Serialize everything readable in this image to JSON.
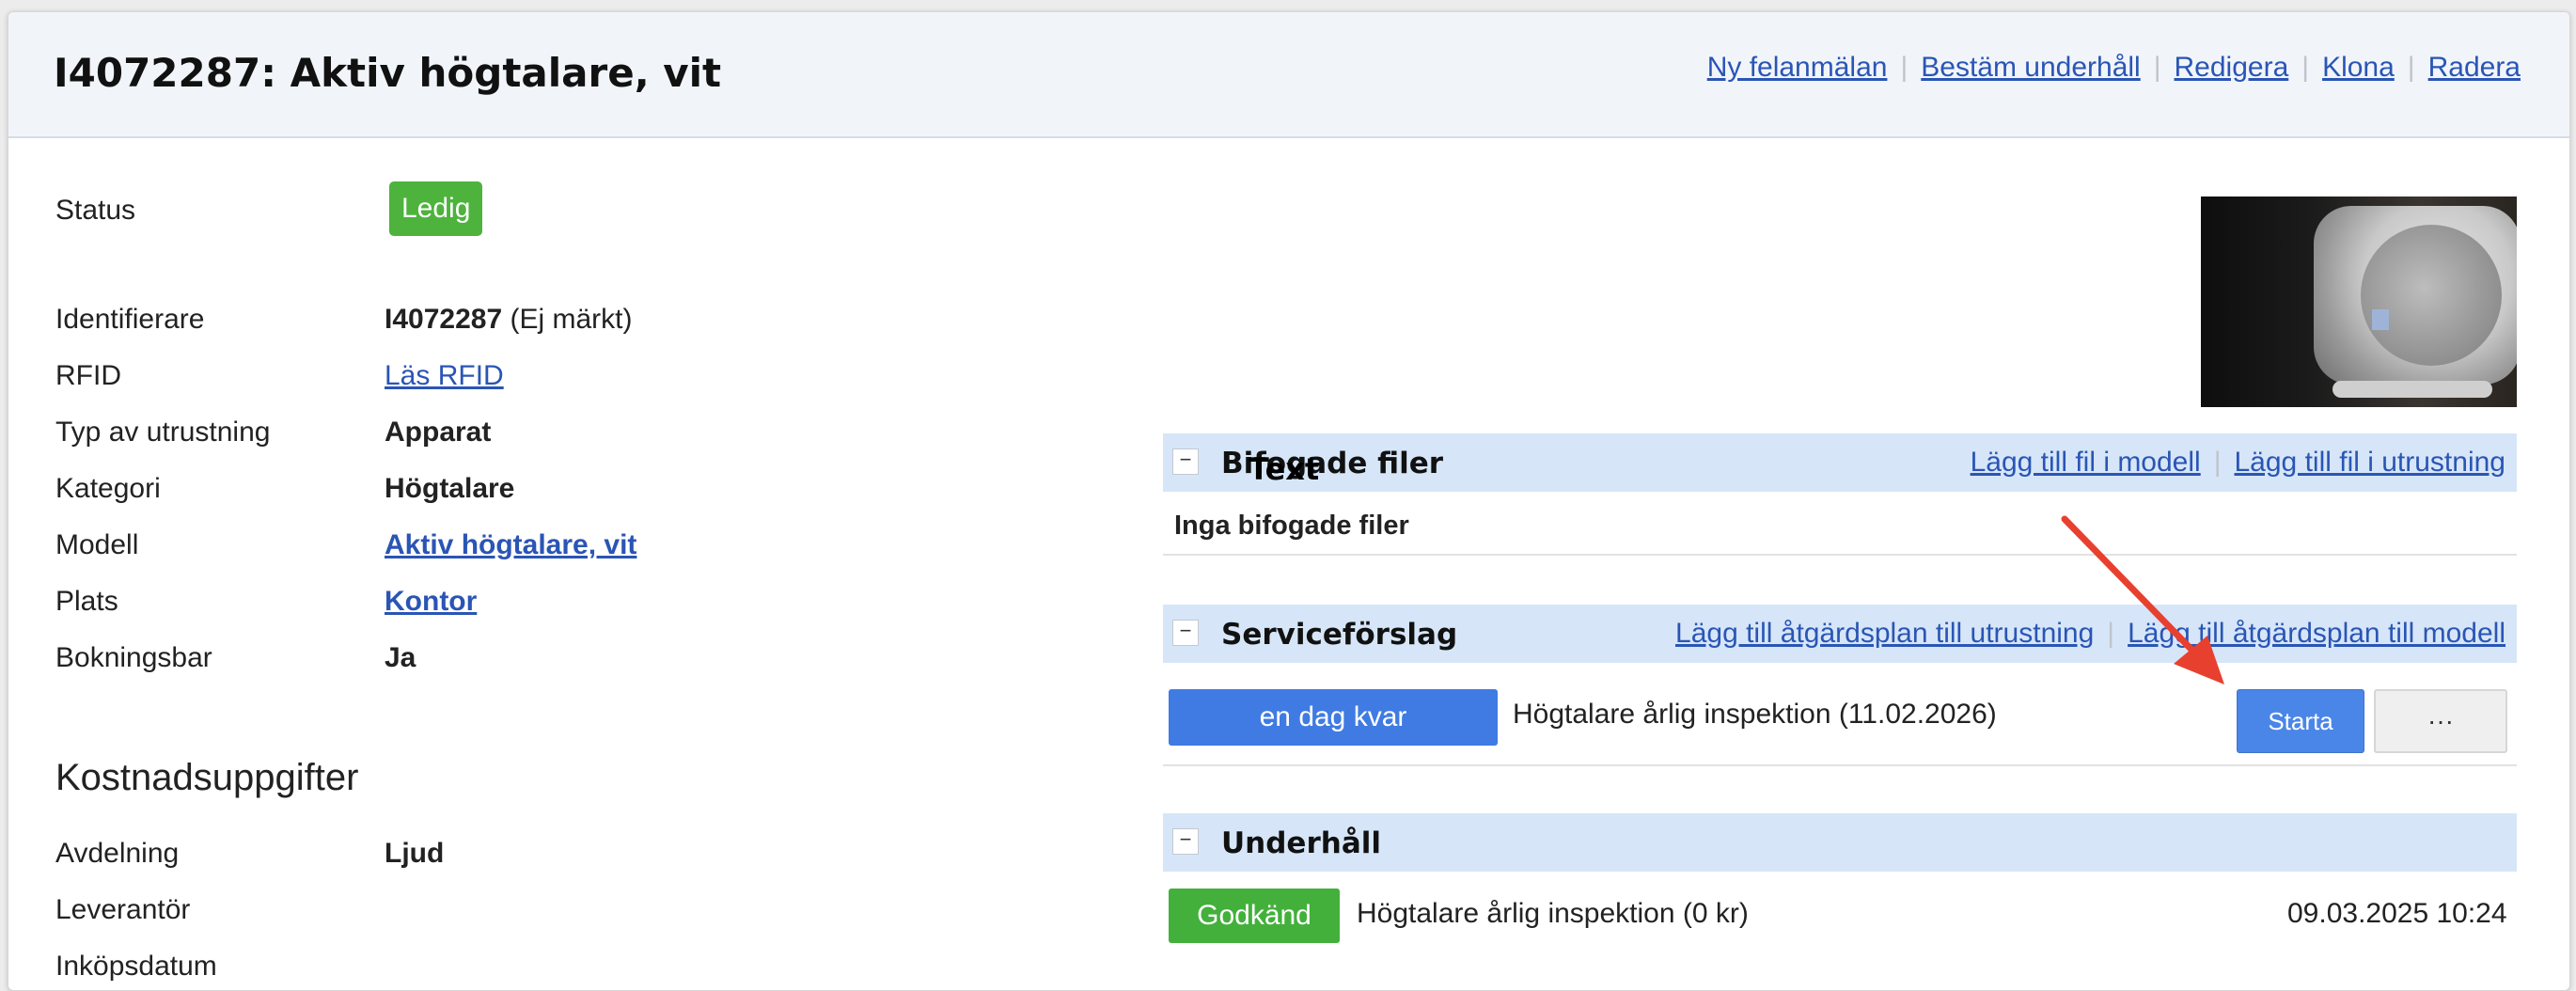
{
  "header": {
    "title": "I4072287: Aktiv högtalare, vit",
    "actions": [
      "Ny felanmälan",
      "Bestäm underhåll",
      "Redigera",
      "Klona",
      "Radera"
    ]
  },
  "details": {
    "status_label": "Status",
    "status_badge": "Ledig",
    "identifier_label": "Identifierare",
    "identifier_value": "I4072287",
    "identifier_note": "(Ej märkt)",
    "rfid_label": "RFID",
    "rfid_link": "Läs RFID",
    "type_label": "Typ av utrustning",
    "type_value": "Apparat",
    "category_label": "Kategori",
    "category_value": "Högtalare",
    "model_label": "Modell",
    "model_link": "Aktiv högtalare, vit",
    "place_label": "Plats",
    "place_link": "Kontor",
    "bookable_label": "Bokningsbar",
    "bookable_value": "Ja"
  },
  "costs": {
    "heading": "Kostnadsuppgifter",
    "department_label": "Avdelning",
    "department_value": "Ljud",
    "supplier_label": "Leverantör",
    "purchase_date_label": "Inköpsdatum"
  },
  "attachments": {
    "title": "Bifogade filer",
    "toggle": "−",
    "links": [
      "Lägg till fil i modell",
      "Lägg till fil i utrustning"
    ],
    "empty_text": "Inga bifogade filer"
  },
  "service": {
    "title": "Serviceförslag",
    "toggle": "−",
    "links": [
      "Lägg till åtgärdsplan till utrustning",
      "Lägg till åtgärdsplan till modell"
    ],
    "due_badge": "en dag kvar",
    "task": "Högtalare årlig inspektion (11.02.2026)",
    "start_button": "Starta",
    "more_button": "···"
  },
  "maintenance": {
    "title": "Underhåll",
    "toggle": "−",
    "status_badge": "Godkänd",
    "entry": "Högtalare årlig inspektion (0 kr)",
    "timestamp": "09.03.2025 10:24"
  },
  "annotation": {
    "text": "Text",
    "arrow_color": "#e8402f"
  }
}
